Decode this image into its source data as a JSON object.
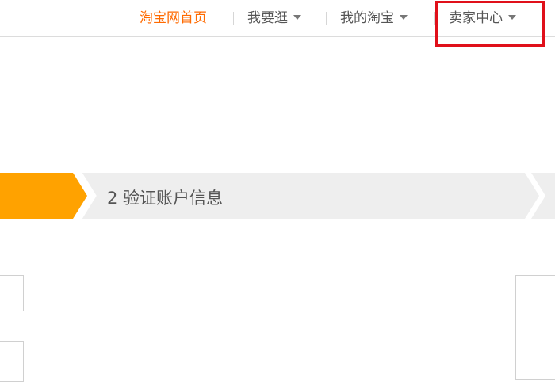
{
  "topnav": {
    "home": "淘宝网首页",
    "shop": "我要逛",
    "my_taobao": "我的淘宝",
    "seller_center": "卖家中心"
  },
  "steps": {
    "step2_label": "2 验证账户信息",
    "active_color": "#ffa200",
    "inactive_color": "#eeeeee"
  },
  "highlight_color": "#e0101a"
}
